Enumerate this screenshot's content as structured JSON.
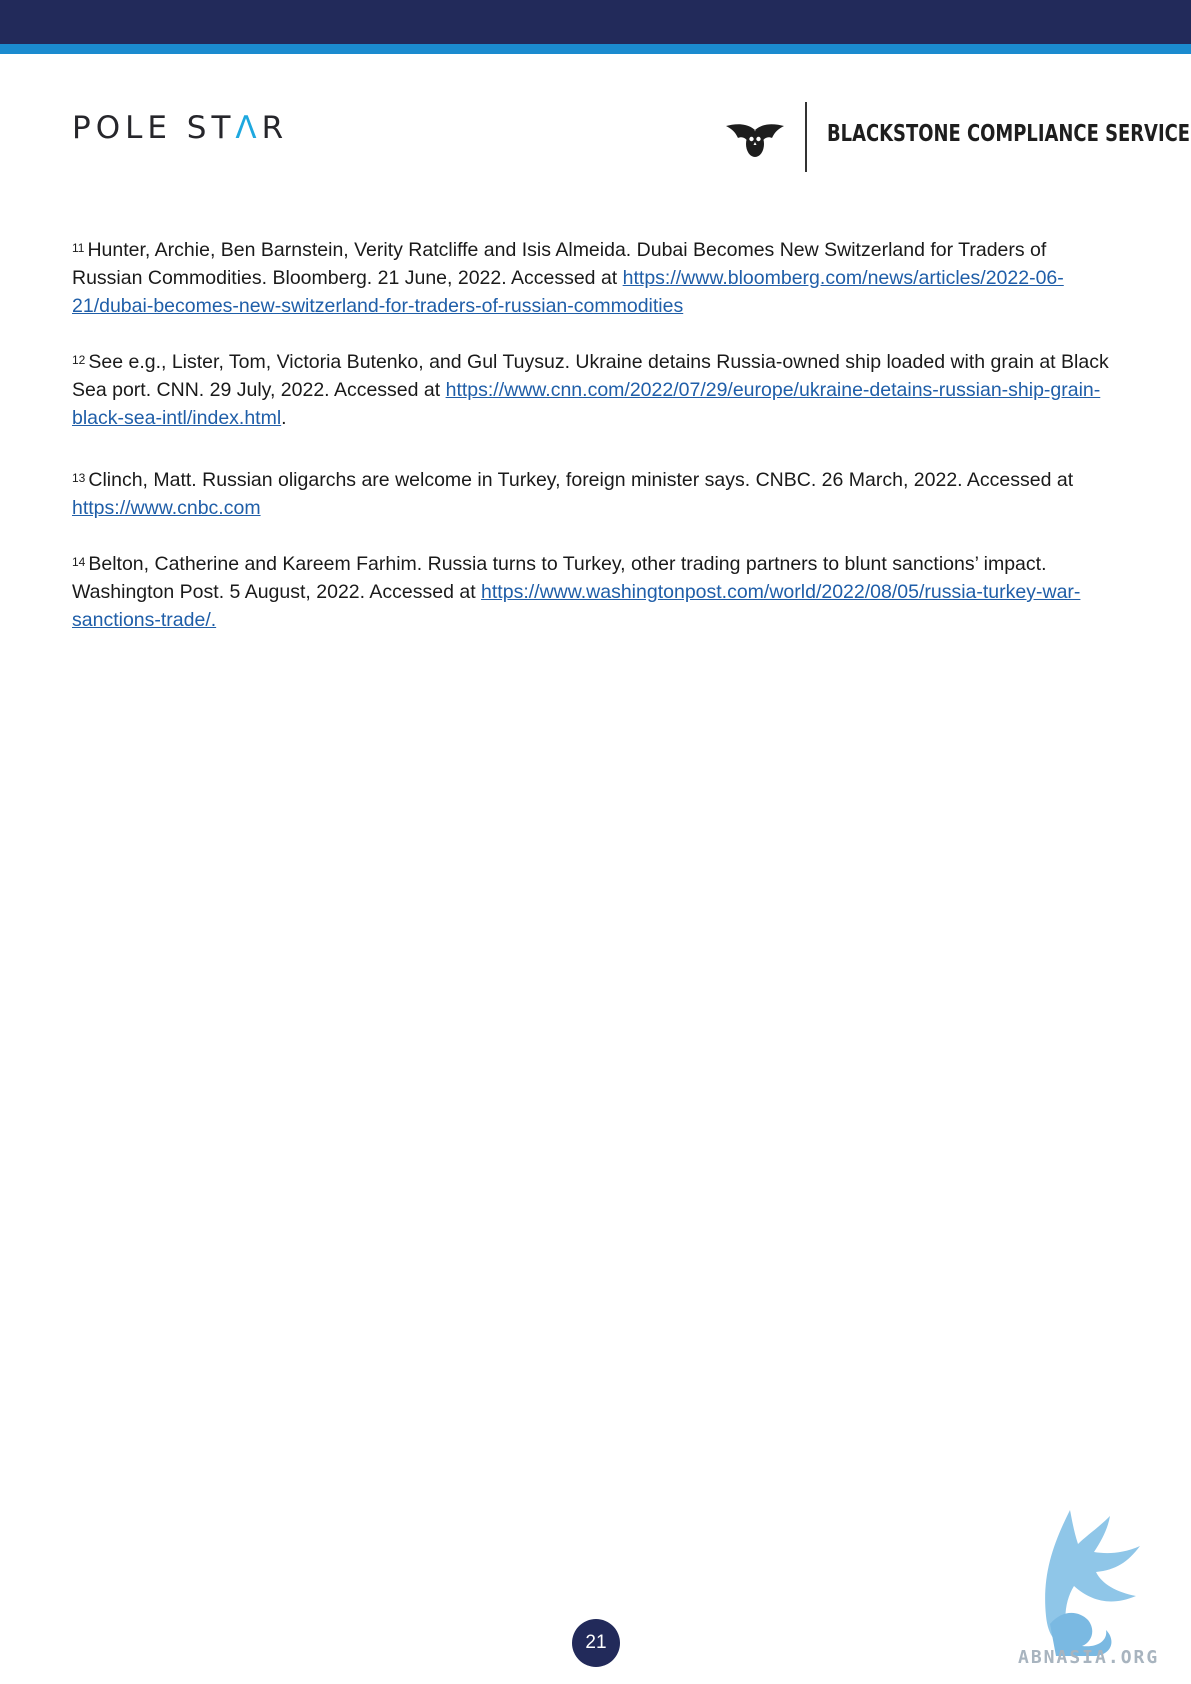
{
  "header": {
    "logo_left_main": "POLE ST",
    "logo_left_accent": "Λ",
    "logo_left_end": "R",
    "logo_right": "BLACKSTONE COMPLIANCE SERVICES"
  },
  "references": [
    {
      "num": "11",
      "text": "Hunter, Archie, Ben Barnstein, Verity Ratcliffe and Isis Almeida. Dubai Becomes New Switzerland for Traders of Russian Commodities. Bloomberg. 21 June, 2022. Accessed at",
      "link": "https://www.bloomberg.com/news/articles/2022-06-21/dubai-becomes-new-switzerland-for-traders-of-russian-commodities",
      "trailing": ""
    },
    {
      "num": "12",
      "text": "See e.g., Lister, Tom, Victoria Butenko, and Gul Tuysuz. Ukraine detains Russia-owned ship loaded with grain at Black Sea port. CNN. 29 July, 2022. Accessed at",
      "link": "https://www.cnn.com/2022/07/29/europe/ukraine-detains-russian-ship-grain-black-sea-intl/index.html",
      "trailing": "."
    },
    {
      "num": "13",
      "text": "Clinch, Matt. Russian oligarchs are welcome in Turkey, foreign minister says. CNBC. 26 March, 2022. Accessed at",
      "link": "https://www.cnbc.com",
      "trailing": ""
    },
    {
      "num": "14",
      "text": "Belton, Catherine and Kareem Farhim. Russia turns to Turkey, other trading partners to blunt sanctions’ impact. Washington Post. 5 August, 2022. Accessed at",
      "link": "https://www.washingtonpost.com/world/2022/08/05/russia-turkey-war-sanctions-trade/.",
      "trailing": ""
    }
  ],
  "page_number": "21",
  "watermark_text": "ABNASIA.ORG",
  "colors": {
    "header_bar": "#222a5a",
    "header_stripe": "#1b8bcf",
    "link": "#1f5ea8"
  }
}
